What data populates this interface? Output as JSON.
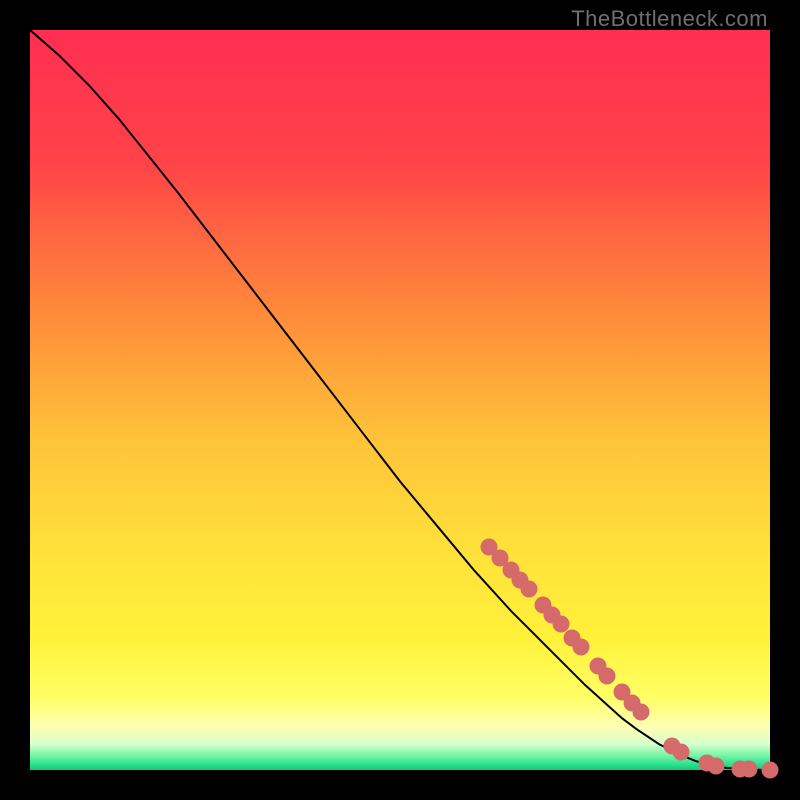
{
  "watermark": "TheBottleneck.com",
  "chart_data": {
    "type": "line",
    "title": "",
    "xlabel": "",
    "ylabel": "",
    "xlim": [
      0,
      100
    ],
    "ylim": [
      0,
      100
    ],
    "gradient_stops": [
      {
        "pct": 0,
        "color": "#ff2e52"
      },
      {
        "pct": 18,
        "color": "#ff4348"
      },
      {
        "pct": 38,
        "color": "#ff8a3a"
      },
      {
        "pct": 55,
        "color": "#ffc23a"
      },
      {
        "pct": 70,
        "color": "#ffe03a"
      },
      {
        "pct": 82,
        "color": "#fff13a"
      },
      {
        "pct": 90,
        "color": "#ffff64"
      },
      {
        "pct": 94,
        "color": "#ffffb0"
      },
      {
        "pct": 96.5,
        "color": "#d8ffcc"
      },
      {
        "pct": 98,
        "color": "#79f5a8"
      },
      {
        "pct": 99.2,
        "color": "#2fe28f"
      },
      {
        "pct": 100,
        "color": "#14c877"
      }
    ],
    "series": [
      {
        "name": "curve",
        "x": [
          0,
          4,
          8,
          12,
          16,
          20,
          25,
          30,
          35,
          40,
          45,
          50,
          55,
          60,
          65,
          70,
          75,
          80,
          82,
          85,
          88,
          90,
          92,
          94,
          96,
          98,
          100
        ],
        "y": [
          100,
          96.5,
          92.5,
          88,
          83,
          78,
          71.5,
          65,
          58.5,
          52,
          45.5,
          39,
          33,
          27,
          21.5,
          16.5,
          11.5,
          7,
          5.5,
          3.5,
          2,
          1.2,
          0.6,
          0.3,
          0.15,
          0.05,
          0
        ]
      }
    ],
    "dots": {
      "name": "highlight-points",
      "color": "#d46a6a",
      "points": [
        {
          "x": 62,
          "y": 30.2
        },
        {
          "x": 63.5,
          "y": 28.6
        },
        {
          "x": 65,
          "y": 27.0
        },
        {
          "x": 66.2,
          "y": 25.7
        },
        {
          "x": 67.4,
          "y": 24.4
        },
        {
          "x": 69.3,
          "y": 22.3
        },
        {
          "x": 70.5,
          "y": 21.0
        },
        {
          "x": 71.7,
          "y": 19.7
        },
        {
          "x": 73.3,
          "y": 17.9
        },
        {
          "x": 74.5,
          "y": 16.6
        },
        {
          "x": 76.8,
          "y": 14.0
        },
        {
          "x": 78.0,
          "y": 12.7
        },
        {
          "x": 80.0,
          "y": 10.5
        },
        {
          "x": 81.3,
          "y": 9.1
        },
        {
          "x": 82.5,
          "y": 7.8
        },
        {
          "x": 86.8,
          "y": 3.3
        },
        {
          "x": 88.0,
          "y": 2.4
        },
        {
          "x": 91.5,
          "y": 0.9
        },
        {
          "x": 92.7,
          "y": 0.6
        },
        {
          "x": 96.0,
          "y": 0.15
        },
        {
          "x": 97.2,
          "y": 0.08
        },
        {
          "x": 100.0,
          "y": 0
        }
      ]
    }
  }
}
